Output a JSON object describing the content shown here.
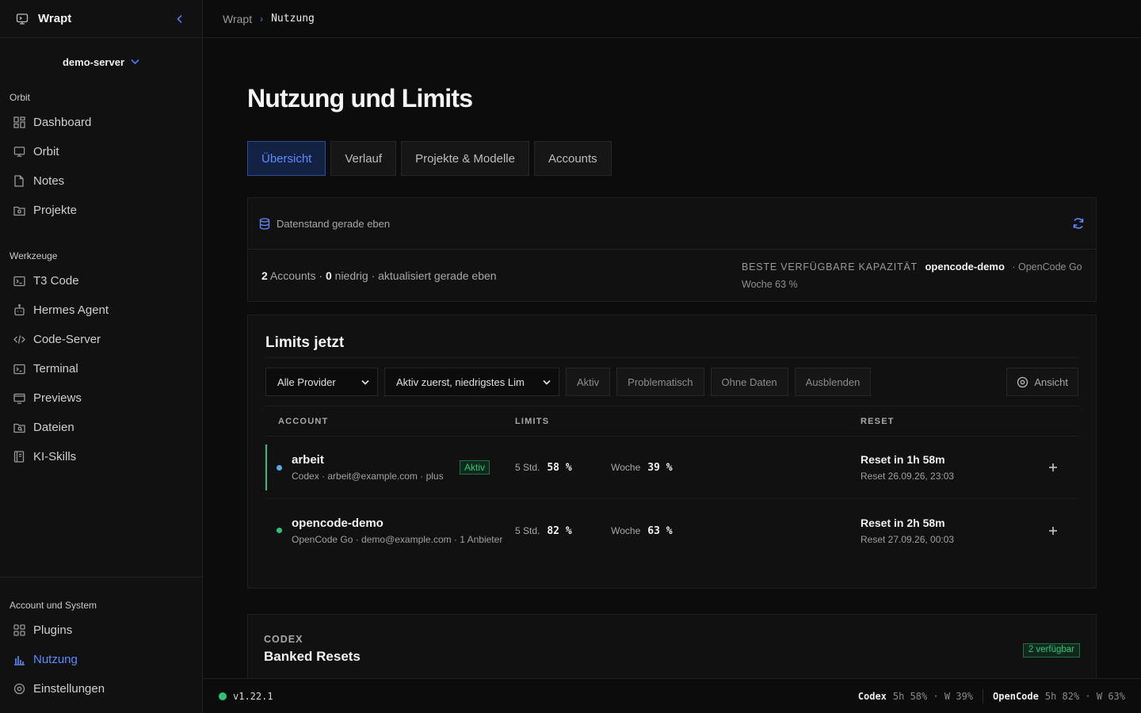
{
  "app": {
    "name": "Wrapt",
    "server": "demo-server"
  },
  "sidebar": {
    "groups": [
      {
        "label": "Orbit",
        "items": [
          {
            "label": "Dashboard",
            "icon": "grid-icon"
          },
          {
            "label": "Orbit",
            "icon": "monitor-icon"
          },
          {
            "label": "Notes",
            "icon": "file-icon"
          },
          {
            "label": "Projekte",
            "icon": "folder-icon"
          }
        ]
      },
      {
        "label": "Werkzeuge",
        "items": [
          {
            "label": "T3 Code",
            "icon": "terminal-square-icon"
          },
          {
            "label": "Hermes Agent",
            "icon": "bot-icon"
          },
          {
            "label": "Code-Server",
            "icon": "code-icon"
          },
          {
            "label": "Terminal",
            "icon": "terminal-icon"
          },
          {
            "label": "Previews",
            "icon": "preview-icon"
          },
          {
            "label": "Dateien",
            "icon": "folder-search-icon"
          },
          {
            "label": "KI-Skills",
            "icon": "book-icon"
          }
        ]
      }
    ],
    "bottom": {
      "label": "Account und System",
      "items": [
        {
          "label": "Plugins",
          "icon": "plugins-icon"
        },
        {
          "label": "Nutzung",
          "icon": "bar-chart-icon",
          "active": true
        },
        {
          "label": "Einstellungen",
          "icon": "gear-icon"
        }
      ]
    }
  },
  "breadcrumb": {
    "root": "Wrapt",
    "current": "Nutzung"
  },
  "page": {
    "title": "Nutzung und Limits"
  },
  "tabs": [
    {
      "label": "Übersicht",
      "active": true
    },
    {
      "label": "Verlauf"
    },
    {
      "label": "Projekte & Modelle"
    },
    {
      "label": "Accounts"
    }
  ],
  "status": {
    "text": "Datenstand gerade eben"
  },
  "summary": {
    "accounts_count": "2",
    "accounts_label": "Accounts",
    "low_count": "0",
    "low_label": "niedrig · aktualisiert gerade eben",
    "best_label": "BESTE VERFÜGBARE KAPAZITÄT",
    "best_account": "opencode-demo",
    "best_provider": "· OpenCode Go",
    "best_week": "Woche 63 %"
  },
  "limits": {
    "title": "Limits jetzt",
    "provider_select": "Alle Provider",
    "sort_select": "Aktiv zuerst, niedrigstes Lim",
    "chips": [
      "Aktiv",
      "Problematisch",
      "Ohne Daten",
      "Ausblenden"
    ],
    "view_label": "Ansicht",
    "columns": {
      "account": "ACCOUNT",
      "limits": "LIMITS",
      "reset": "RESET"
    },
    "rows": [
      {
        "name": "arbeit",
        "sub": "Codex · arbeit@example.com · plus",
        "badge": "Aktiv",
        "dot_color": "#5aa9f0",
        "active": true,
        "l1_label": "5 Std.",
        "l1_value": "58 %",
        "l2_label": "Woche",
        "l2_value": "39 %",
        "reset_main": "Reset in 1h 58m",
        "reset_sub": "Reset 26.09.26, 23:03"
      },
      {
        "name": "opencode-demo",
        "sub": "OpenCode Go · demo@example.com · 1 Anbieter",
        "badge": "",
        "dot_color": "#2fc37a",
        "active": false,
        "l1_label": "5 Std.",
        "l1_value": "82 %",
        "l2_label": "Woche",
        "l2_value": "63 %",
        "reset_main": "Reset in 2h 58m",
        "reset_sub": "Reset 27.09.26, 00:03"
      }
    ]
  },
  "codex": {
    "kicker": "CODEX",
    "title": "Banked Resets",
    "badge": "2 verfügbar"
  },
  "footer": {
    "version": "v1.22.1",
    "codex_label": "Codex",
    "codex_stats": "5h 58% · W 39%",
    "opencode_label": "OpenCode",
    "opencode_stats": "5h 82% · W 63%"
  },
  "colors": {
    "accent": "#5b8cff",
    "success": "#2fc37a",
    "background": "#0b0b0b"
  }
}
